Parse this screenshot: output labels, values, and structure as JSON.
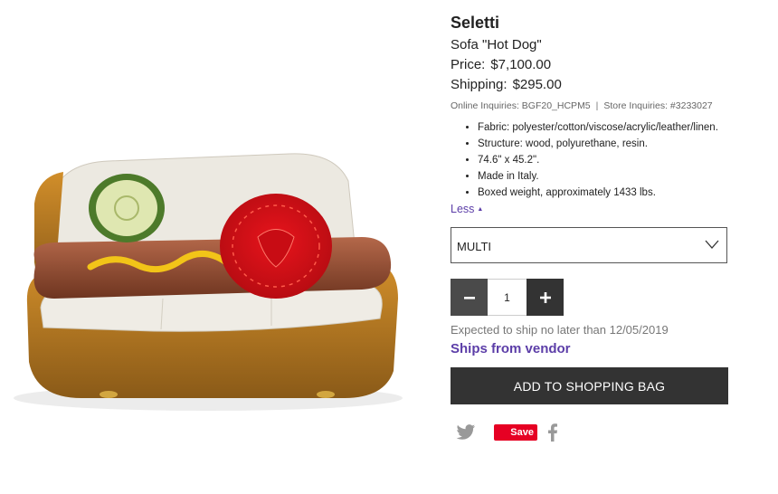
{
  "product": {
    "brand": "Seletti",
    "name": "Sofa \"Hot Dog\"",
    "price_label": "Price:",
    "price_value": "$7,100.00",
    "shipping_label": "Shipping:",
    "shipping_value": "$295.00",
    "online_inquiries": "Online Inquiries: BGF20_HCPM5",
    "separator": "|",
    "store_inquiries": "Store Inquiries: #3233027",
    "features": [
      "Fabric: polyester/cotton/viscose/acrylic/leather/linen.",
      "Structure: wood, polyurethane, resin.",
      "74.6\" x 45.2\".",
      "Made in Italy.",
      "Boxed weight, approximately 1433 lbs."
    ],
    "less_label": "Less",
    "image_icon": "hot-dog-sofa-image"
  },
  "variant": {
    "selected": "MULTI",
    "icon": "chevron-down-icon"
  },
  "quantity": {
    "value": "1",
    "minus_icon": "minus-icon",
    "plus_icon": "plus-icon"
  },
  "shipping_info": {
    "expected": "Expected to ship no later than 12/05/2019",
    "vendor": "Ships from vendor"
  },
  "actions": {
    "add_to_bag": "ADD TO SHOPPING BAG"
  },
  "social": {
    "twitter_icon": "twitter-icon",
    "pinterest_label": "Save",
    "facebook_icon": "facebook-icon"
  },
  "colors": {
    "accent_purple": "#5c3ea8",
    "button_dark": "#333333",
    "pinterest_red": "#e60023",
    "text_muted": "#777777"
  }
}
